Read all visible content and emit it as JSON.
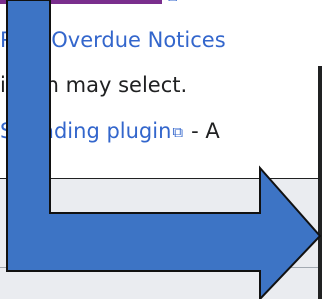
{
  "document": {
    "line1_link": "Pa  n Overdue Notices",
    "line2_text": "il  rian may select.",
    "line3_link": "S  reading plugin",
    "line3_external_icon": "external-link-icon",
    "line3_trailing": "- A",
    "top_external_icon": "external-link-icon"
  },
  "overlay": {
    "arrow_icon": "arrow-down-right-icon",
    "arrow_color": "#3d74c5",
    "arrow_outline": "#111111"
  },
  "colors": {
    "link": "#3366cc",
    "text": "#202122",
    "panel": "#eaecf0",
    "underline": "#7a2e8d"
  }
}
